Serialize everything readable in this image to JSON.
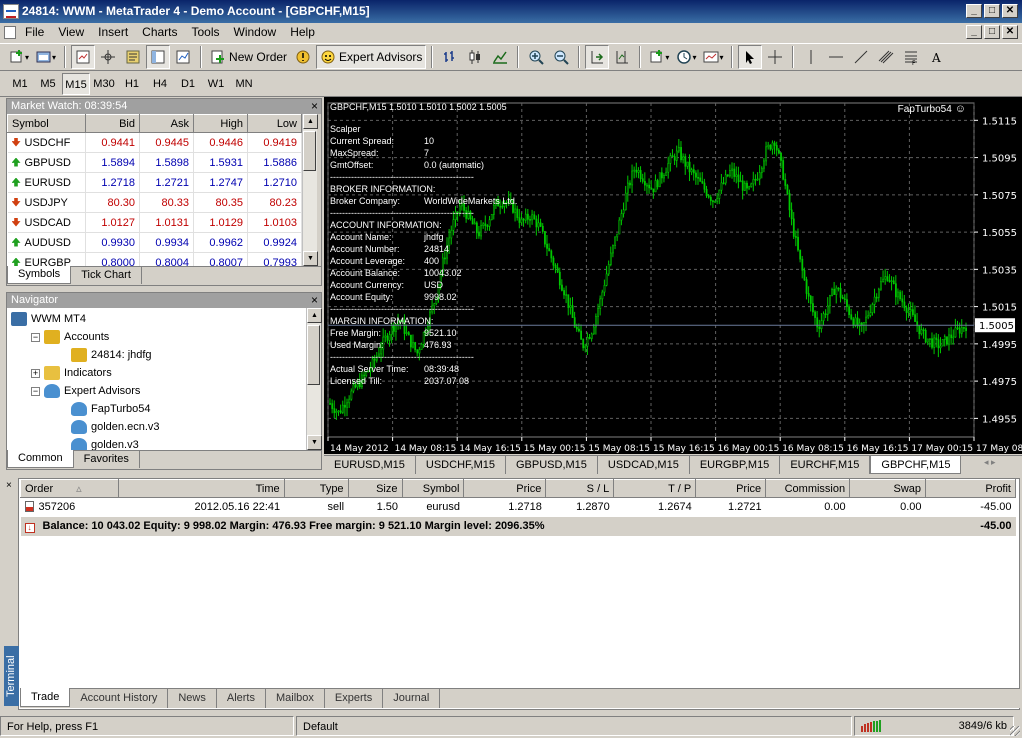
{
  "window": {
    "title": "24814: WWM - MetaTrader 4 - Demo Account - [GBPCHF,M15]",
    "min_glyph": "_",
    "max_glyph": "□",
    "close_glyph": "✕"
  },
  "menu": [
    "File",
    "View",
    "Insert",
    "Charts",
    "Tools",
    "Window",
    "Help"
  ],
  "toolbar": {
    "new_order": "New Order",
    "expert_advisors": "Expert Advisors"
  },
  "timeframes": [
    "M1",
    "M5",
    "M15",
    "M30",
    "H1",
    "H4",
    "D1",
    "W1",
    "MN"
  ],
  "timeframe_selected": "M15",
  "market_watch": {
    "title": "Market Watch: 08:39:54",
    "columns": [
      "Symbol",
      "Bid",
      "Ask",
      "High",
      "Low"
    ],
    "rows": [
      {
        "symbol": "USDCHF",
        "dir": "down",
        "color": "red",
        "bid": "0.9441",
        "ask": "0.9445",
        "high": "0.9446",
        "low": "0.9419"
      },
      {
        "symbol": "GBPUSD",
        "dir": "up",
        "color": "blue",
        "bid": "1.5894",
        "ask": "1.5898",
        "high": "1.5931",
        "low": "1.5886"
      },
      {
        "symbol": "EURUSD",
        "dir": "up",
        "color": "blue",
        "bid": "1.2718",
        "ask": "1.2721",
        "high": "1.2747",
        "low": "1.2710"
      },
      {
        "symbol": "USDJPY",
        "dir": "down",
        "color": "red",
        "bid": "80.30",
        "ask": "80.33",
        "high": "80.35",
        "low": "80.23"
      },
      {
        "symbol": "USDCAD",
        "dir": "down",
        "color": "red",
        "bid": "1.0127",
        "ask": "1.0131",
        "high": "1.0129",
        "low": "1.0103"
      },
      {
        "symbol": "AUDUSD",
        "dir": "up",
        "color": "blue",
        "bid": "0.9930",
        "ask": "0.9934",
        "high": "0.9962",
        "low": "0.9924"
      },
      {
        "symbol": "EURGBP",
        "dir": "up",
        "color": "blue",
        "bid": "0.8000",
        "ask": "0.8004",
        "high": "0.8007",
        "low": "0.7993"
      }
    ],
    "tabs": [
      "Symbols",
      "Tick Chart"
    ]
  },
  "navigator": {
    "title": "Navigator",
    "items": [
      {
        "label": "WWM MT4",
        "level": 0,
        "icon": "mt4-icon",
        "exp": ""
      },
      {
        "label": "Accounts",
        "level": 1,
        "icon": "accounts-icon",
        "exp": "−"
      },
      {
        "label": "24814: jhdfg",
        "level": 2,
        "icon": "user-icon",
        "exp": ""
      },
      {
        "label": "Indicators",
        "level": 1,
        "icon": "indicator-icon",
        "exp": "+"
      },
      {
        "label": "Expert Advisors",
        "level": 1,
        "icon": "expert-hat-icon",
        "exp": "−"
      },
      {
        "label": "FapTurbo54",
        "level": 2,
        "icon": "expert-hat-icon",
        "exp": ""
      },
      {
        "label": "golden.ecn.v3",
        "level": 2,
        "icon": "expert-hat-icon",
        "exp": ""
      },
      {
        "label": "golden.v3",
        "level": 2,
        "icon": "expert-hat-icon",
        "exp": ""
      }
    ],
    "tabs": [
      "Common",
      "Favorites"
    ]
  },
  "chart": {
    "header": "GBPCHF,M15  1.5010 1.5010 1.5002 1.5005",
    "ea_label": "FapTurbo54",
    "overlay": [
      {
        "k": "Scalper",
        "v": ""
      },
      {
        "k": "Current Spread:",
        "v": "10"
      },
      {
        "k": "MaxSpread:",
        "v": "7"
      },
      {
        "k": "GmtOffset:",
        "v": "0.0 (automatic)"
      },
      {
        "k": "------------------------------------------------",
        "v": ""
      },
      {
        "k": "BROKER INFORMATION:",
        "v": ""
      },
      {
        "k": "Broker Company:",
        "v": "WorldWideMarkets Ltd."
      },
      {
        "k": "------------------------------------------------",
        "v": ""
      },
      {
        "k": "ACCOUNT INFORMATION:",
        "v": ""
      },
      {
        "k": "Account Name:",
        "v": "jhdfg"
      },
      {
        "k": "Account Number:",
        "v": "24814"
      },
      {
        "k": "Account Leverage:",
        "v": "400"
      },
      {
        "k": "Account Balance:",
        "v": "10043.02"
      },
      {
        "k": "Account Currency:",
        "v": "USD"
      },
      {
        "k": "Account Equity:",
        "v": "9998.02"
      },
      {
        "k": "------------------------------------------------",
        "v": ""
      },
      {
        "k": "MARGIN INFORMATION:",
        "v": ""
      },
      {
        "k": "Free Margin:",
        "v": "9521.10"
      },
      {
        "k": "Used Margin:",
        "v": "476.93"
      },
      {
        "k": "------------------------------------------------",
        "v": ""
      },
      {
        "k": "Actual Server Time:",
        "v": "08:39:48"
      },
      {
        "k": "Licensed Till:",
        "v": "2037.07.08"
      }
    ],
    "price_axis": [
      "1.5115",
      "1.5095",
      "1.5075",
      "1.5055",
      "1.5035",
      "1.5015",
      "1.4995",
      "1.4975",
      "1.4955"
    ],
    "current_price": "1.5005",
    "time_axis": [
      "14 May 2012",
      "14 May 08:15",
      "14 May 16:15",
      "15 May 00:15",
      "15 May 08:15",
      "15 May 16:15",
      "16 May 00:15",
      "16 May 08:15",
      "16 May 16:15",
      "17 May 00:15",
      "17 May 08:15"
    ],
    "close_series": [
      1.4963,
      1.4958,
      1.4966,
      1.4972,
      1.4978,
      1.4985,
      1.4995,
      1.5003,
      1.5008,
      1.4998,
      1.499,
      1.5004,
      1.5018,
      1.504,
      1.5058,
      1.507,
      1.5062,
      1.5054,
      1.506,
      1.507,
      1.5072,
      1.5068,
      1.506,
      1.5064,
      1.5058,
      1.5046,
      1.5034,
      1.5022,
      1.5006,
      1.4994,
      1.5002,
      1.5018,
      1.5038,
      1.5056,
      1.5076,
      1.509,
      1.5084,
      1.5078,
      1.5085,
      1.5093,
      1.5098,
      1.509,
      1.5084,
      1.5078,
      1.5072,
      1.508,
      1.5088,
      1.5082,
      1.5076,
      1.5085,
      1.5098,
      1.5105,
      1.5086,
      1.506,
      1.5038,
      1.5018,
      1.5004,
      1.5014,
      1.5026,
      1.5018,
      1.5008,
      1.5002,
      1.5014,
      1.5026,
      1.5032,
      1.5022,
      1.5016,
      1.5008,
      1.5,
      1.4996,
      1.4994,
      1.4998,
      1.5002,
      1.5005
    ]
  },
  "chart_tabs": [
    "EURUSD,M15",
    "USDCHF,M15",
    "GBPUSD,M15",
    "USDCAD,M15",
    "EURGBP,M15",
    "EURCHF,M15",
    "GBPCHF,M15"
  ],
  "chart_tab_active": "GBPCHF,M15",
  "terminal": {
    "label": "Terminal",
    "columns": [
      "Order",
      "Time",
      "Type",
      "Size",
      "Symbol",
      "Price",
      "S / L",
      "T / P",
      "Price",
      "Commission",
      "Swap",
      "Profit"
    ],
    "orders": [
      [
        "357206",
        "2012.05.16 22:41",
        "sell",
        "1.50",
        "eurusd",
        "1.2718",
        "1.2870",
        "1.2674",
        "1.2721",
        "0.00",
        "0.00",
        "-45.00"
      ]
    ],
    "balance_line": "Balance: 10 043.02  Equity: 9 998.02  Margin: 476.93  Free margin: 9 521.10  Margin level: 2096.35%",
    "balance_profit": "-45.00",
    "tabs": [
      "Trade",
      "Account History",
      "News",
      "Alerts",
      "Mailbox",
      "Experts",
      "Journal"
    ]
  },
  "status": {
    "help": "For Help, press F1",
    "profile": "Default",
    "traffic": "3849/6 kb"
  },
  "colors": {
    "bull": "#00c800",
    "bear": "#00c800",
    "chart_bg": "#000000",
    "grid": "#606060"
  }
}
